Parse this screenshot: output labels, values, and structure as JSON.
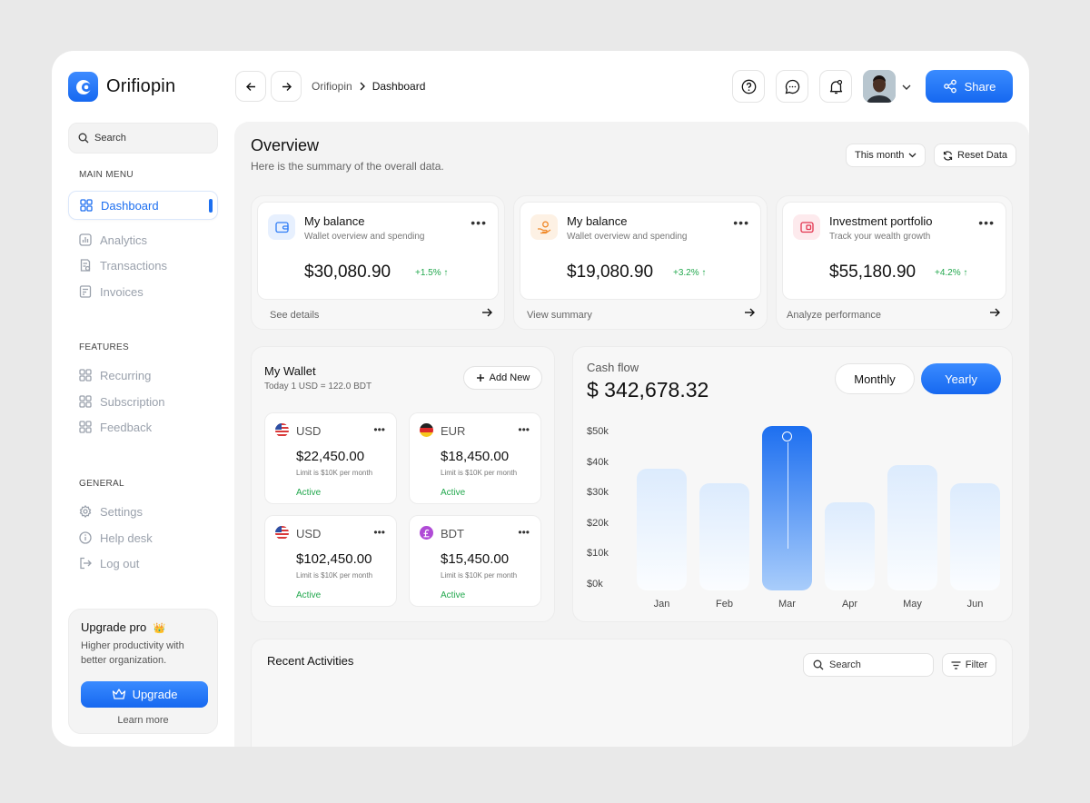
{
  "app": {
    "name": "Orifiopin"
  },
  "sidebar": {
    "search_placeholder": "Search",
    "main_menu_title": "MAIN MENU",
    "main_menu": [
      {
        "label": "Dashboard",
        "icon": "grid-icon",
        "active": true
      },
      {
        "label": "Analytics",
        "icon": "chart-icon"
      },
      {
        "label": "Transactions",
        "icon": "receipt-icon"
      },
      {
        "label": "Invoices",
        "icon": "invoice-icon"
      }
    ],
    "features_title": "FEATURES",
    "features": [
      {
        "label": "Recurring",
        "icon": "grid-icon"
      },
      {
        "label": "Subscription",
        "icon": "grid-icon"
      },
      {
        "label": "Feedback",
        "icon": "grid-icon"
      }
    ],
    "general_title": "GENERAL",
    "general": [
      {
        "label": "Settings",
        "icon": "gear-icon"
      },
      {
        "label": "Help desk",
        "icon": "info-icon"
      },
      {
        "label": "Log out",
        "icon": "logout-icon"
      }
    ],
    "upgrade": {
      "title": "Upgrade pro",
      "crown": "👑",
      "description": "Higher productivity with better organization.",
      "button": "Upgrade",
      "learn_more": "Learn more"
    }
  },
  "header": {
    "breadcrumb": [
      "Orifiopin",
      "Dashboard"
    ],
    "share_label": "Share"
  },
  "overview": {
    "title": "Overview",
    "subtitle": "Here is the summary of the overall data.",
    "period": "This month",
    "reset": "Reset Data"
  },
  "cards": [
    {
      "title": "My balance",
      "subtitle": "Wallet overview and spending",
      "amount": "$30,080.90",
      "change": "+1.5%",
      "footer": "See details",
      "icon": "wallet-icon",
      "accent": "#2f7df6"
    },
    {
      "title": "My balance",
      "subtitle": "Wallet overview and spending",
      "amount": "$19,080.90",
      "change": "+3.2%",
      "footer": "View summary",
      "icon": "hand-coin-icon",
      "accent": "#f08a2b"
    },
    {
      "title": "Investment portfolio",
      "subtitle": "Track your wealth growth",
      "amount": "$55,180.90",
      "change": "+4.2%",
      "footer": "Analyze performance",
      "icon": "portfolio-icon",
      "accent": "#e3344f"
    }
  ],
  "wallet": {
    "title": "My Wallet",
    "rate": "Today 1 USD = 122.0 BDT",
    "add_label": "Add New",
    "currencies": [
      {
        "code": "USD",
        "amount": "$22,450.00",
        "limit": "Limit is $10K per month",
        "status": "Active",
        "flag": "us-flag-icon"
      },
      {
        "code": "EUR",
        "amount": "$18,450.00",
        "limit": "Limit is $10K per month",
        "status": "Active",
        "flag": "de-flag-icon"
      },
      {
        "code": "USD",
        "amount": "$102,450.00",
        "limit": "Limit is $10K per month",
        "status": "Active",
        "flag": "us-flag-icon"
      },
      {
        "code": "BDT",
        "amount": "$15,450.00",
        "limit": "Limit is $10K per month",
        "status": "Active",
        "flag": "pound-icon"
      }
    ]
  },
  "cashflow": {
    "label": "Cash flow",
    "total": "$ 342,678.32",
    "toggle_monthly": "Monthly",
    "toggle_yearly": "Yearly",
    "toggle_selected": "Yearly"
  },
  "chart_data": {
    "type": "bar",
    "categories": [
      "Jan",
      "Feb",
      "Mar",
      "Apr",
      "May",
      "Jun"
    ],
    "values": [
      40,
      35,
      54,
      29,
      41,
      35
    ],
    "highlighted": "Mar",
    "y_ticks": [
      "$50k",
      "$40k",
      "$30k",
      "$20k",
      "$10k",
      "$0k"
    ],
    "ylim": [
      0,
      50
    ],
    "xlabel": "",
    "ylabel": "",
    "colors": {
      "bar": "#dcebfd",
      "highlight": "#1d6ff0"
    }
  },
  "recent": {
    "title": "Recent Activities",
    "search_placeholder": "Search",
    "filter_label": "Filter"
  }
}
